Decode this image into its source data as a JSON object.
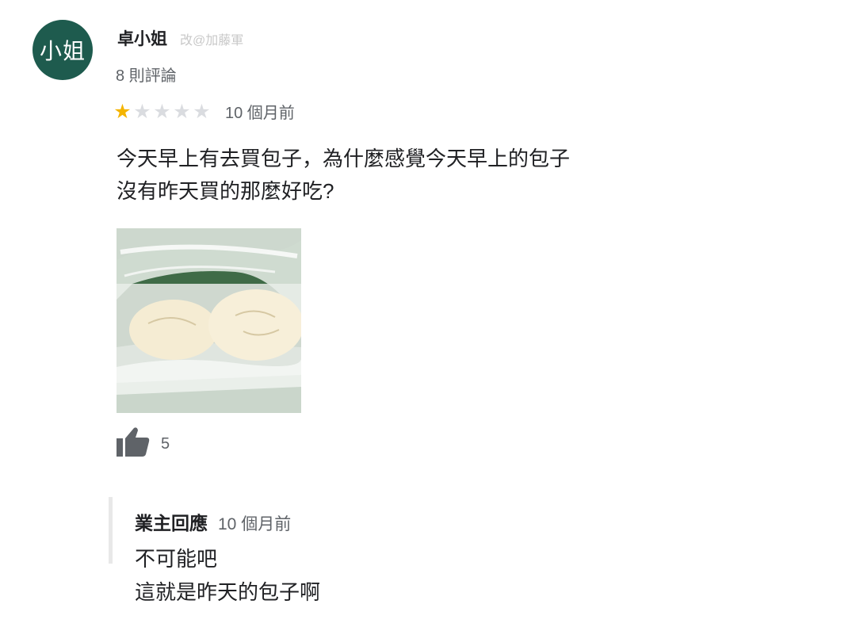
{
  "reviewer": {
    "avatar_text": "小姐",
    "avatar_color": "#1e5b4e",
    "name": "卓小姐",
    "edit_note": "改@加藤軍",
    "review_count": "8 則評論"
  },
  "review": {
    "rating": 1,
    "max_rating": 5,
    "time": "10 個月前",
    "text_lines": [
      "今天早上有去買包子，為什麼感覺今天早上的包子",
      "沒有昨天買的那麼好吃?"
    ],
    "photo_icon": "steamed-buns-photo",
    "like_icon": "thumbs-up-icon",
    "likes": "5"
  },
  "owner_reply": {
    "label": "業主回應",
    "time": "10 個月前",
    "text_lines": [
      "不可能吧",
      "這就是昨天的包子啊"
    ]
  },
  "colors": {
    "star_on": "#f4b400",
    "star_off": "#dadce0"
  }
}
